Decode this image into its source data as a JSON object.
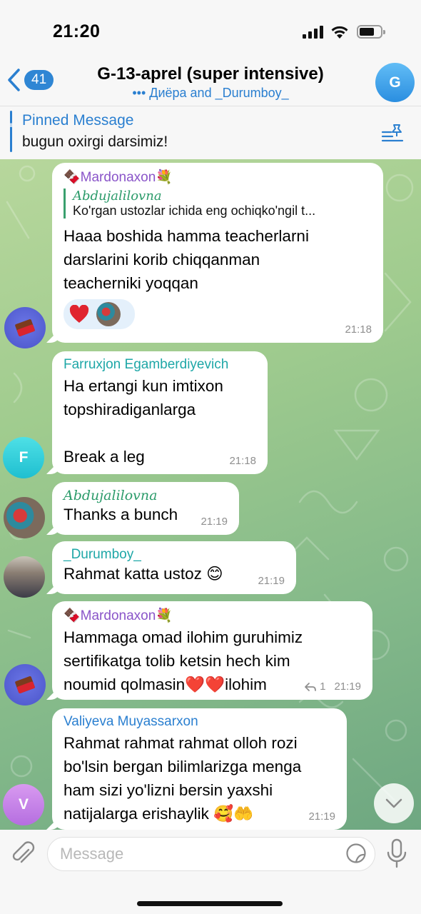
{
  "status_bar": {
    "time": "21:20"
  },
  "header": {
    "back_count": "41",
    "title": "G-13-aprel (super intensive)",
    "subtitle": "••• Диёра and _Durumboy_",
    "avatar_letter": "G"
  },
  "pinned": {
    "title": "Pinned Message",
    "text": "bugun oxirgi darsimiz!"
  },
  "messages": [
    {
      "sender": "🍫Mardonaxon💐",
      "sender_color": "#8a55c9",
      "reply_to": {
        "name": "Abdujalilovna",
        "text": "Ko'rgan ustozlar ichida eng ochiqko'ngil t..."
      },
      "text_lines": [
        "Haaa boshida hamma teacherlarni",
        "darslarini korib chiqqanman",
        "teacherniki yoqqan"
      ],
      "time": "21:18",
      "avatar": "chocolate-avatar"
    },
    {
      "sender": "Farruxjon Egamberdiyevich",
      "sender_color": "#1ea7a7",
      "text_lines": [
        "Ha ertangi kun imtixon",
        "topshiradiganlarga",
        "",
        "Break a leg"
      ],
      "time": "21:18",
      "avatar_letter": "F"
    },
    {
      "sender": "Abdujalilovna",
      "sender_color": "#2b9b6a",
      "text_lines": [
        "Thanks a bunch"
      ],
      "time": "21:19"
    },
    {
      "sender": "_Durumboy_",
      "sender_color": "#1ea7a7",
      "text_lines": [
        "Rahmat katta ustoz 😊"
      ],
      "time": "21:19"
    },
    {
      "sender": "🍫Mardonaxon💐",
      "sender_color": "#8a55c9",
      "text_lines": [
        "Hammaga omad ilohim guruhimiz",
        "sertifikatga tolib ketsin hech kim",
        "noumid qolmasin❤️❤️ilohim"
      ],
      "forward_count": "1",
      "time": "21:19"
    },
    {
      "sender": "Valiyeva Muyassarxon",
      "sender_color": "#2a7fd0",
      "text_lines": [
        "Rahmat rahmat rahmat olloh rozi",
        "bo'lsin bergan bilimlarizga menga",
        "ham sizi yo'lizni bersin yaxshi",
        "natijalarga erishaylik 🥰🤲"
      ],
      "time": "21:19",
      "avatar_letter": "V"
    }
  ],
  "input": {
    "placeholder": "Message"
  },
  "colors": {
    "accent": "#2a7fd0",
    "chat_bg": "#9fcb8e"
  }
}
